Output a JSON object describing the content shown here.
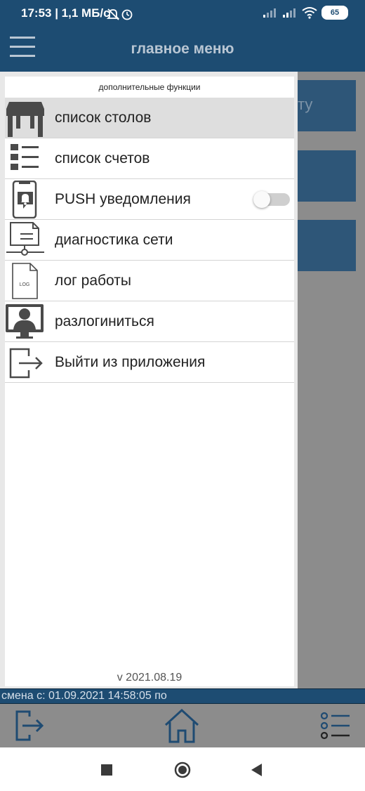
{
  "status_bar": {
    "text": "17:53 | 1,1 МБ/с",
    "battery": "65"
  },
  "app_bar": {
    "title": "главное меню"
  },
  "background": {
    "tile_text": "ту"
  },
  "drawer": {
    "header": "дополнительные функции",
    "items": [
      {
        "label": "список столов",
        "icon": "table-icon"
      },
      {
        "label": "список счетов",
        "icon": "list-icon"
      },
      {
        "label": "PUSH уведомления",
        "icon": "notification-phone-icon"
      },
      {
        "label": "диагностика сети",
        "icon": "network-diagnostics-icon"
      },
      {
        "label": "лог работы",
        "icon": "log-file-icon"
      },
      {
        "label": "разлогиниться",
        "icon": "user-logout-icon"
      },
      {
        "label": "Выйти из приложения",
        "icon": "exit-icon"
      }
    ],
    "push_enabled": false,
    "version": "v 2021.08.19"
  },
  "shift_bar": {
    "text": "смена с: 01.09.2021 14:58:05 по"
  },
  "toolbar": {
    "icons": [
      "exit-icon",
      "home-icon",
      "list-icon"
    ]
  },
  "nav": {
    "icons": [
      "recent-apps-icon",
      "home-nav-icon",
      "back-icon"
    ]
  }
}
